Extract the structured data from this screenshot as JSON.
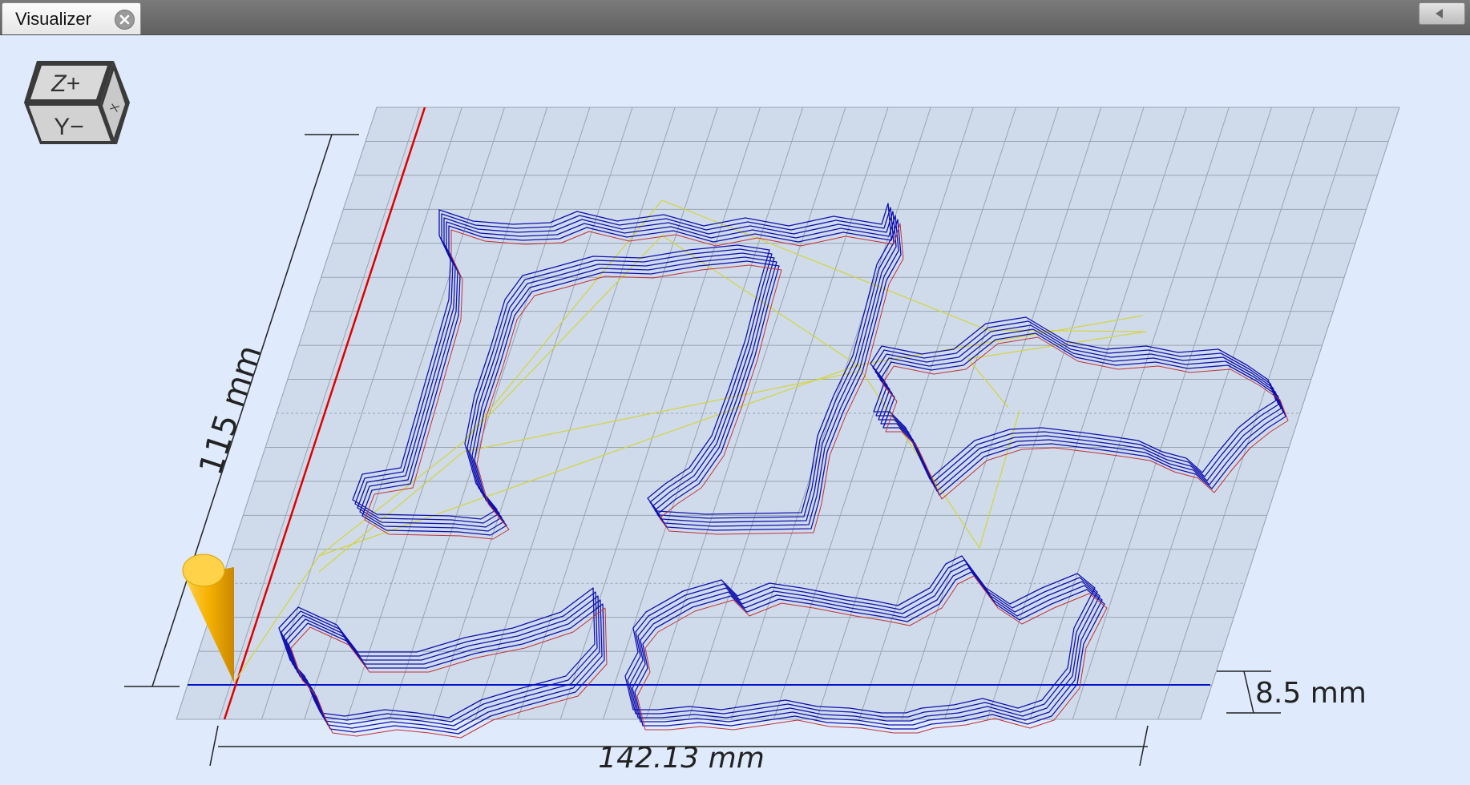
{
  "window": {
    "tab_label": "Visualizer",
    "close_icon": "close-circle-icon",
    "collapse_icon": "chevron-left-icon"
  },
  "view_cube": {
    "top_face": "Z+",
    "front_face": "Y−",
    "side_face": "X"
  },
  "dimensions": {
    "width": "142.13 mm",
    "depth": "115 mm",
    "height": "8.5 mm"
  },
  "colors": {
    "background": "#dfeafc",
    "x_axis": "#e00000",
    "y_axis": "#0012c8",
    "toolpath": "#1010b0",
    "rapid_move": "#d8d840",
    "tool": "#f5b800"
  }
}
